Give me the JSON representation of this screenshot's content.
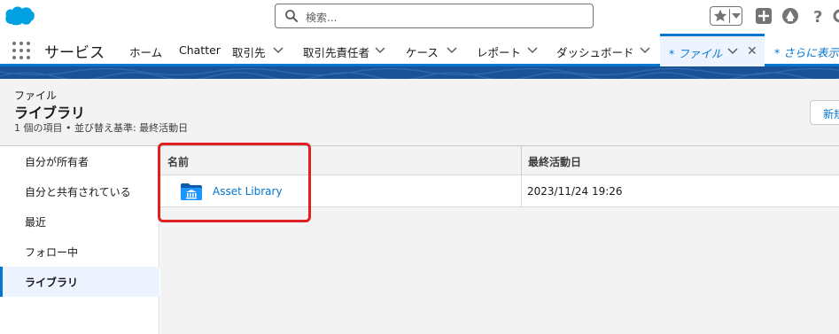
{
  "header": {
    "search_placeholder": "検索...",
    "icons": [
      "salesforce-cloud-logo",
      "search-icon",
      "star-icon",
      "add-icon",
      "trailhead-icon",
      "help-icon",
      "settings-icon"
    ]
  },
  "nav": {
    "app_name": "サービス",
    "tabs": [
      {
        "label": "ホーム",
        "dropdown": false
      },
      {
        "label": "Chatter",
        "dropdown": false
      },
      {
        "label": "取引先",
        "dropdown": true
      },
      {
        "label": "取引先責任者",
        "dropdown": true
      },
      {
        "label": "ケース",
        "dropdown": true
      },
      {
        "label": "レポート",
        "dropdown": true
      },
      {
        "label": "ダッシュボード",
        "dropdown": true
      },
      {
        "label": "* ファイル",
        "dropdown": true,
        "active": true,
        "closable": true
      }
    ],
    "more_label": "* さらに表示"
  },
  "page_header": {
    "eyebrow": "ファイル",
    "title": "ライブラリ",
    "meta": "1 個の項目 • 並び替え基準: 最終活動日",
    "new_button": "新規"
  },
  "sidebar": {
    "items": [
      {
        "label": "自分が所有者"
      },
      {
        "label": "自分と共有されている"
      },
      {
        "label": "最近"
      },
      {
        "label": "フォロー中"
      },
      {
        "label": "ライブラリ",
        "selected": true
      }
    ]
  },
  "table": {
    "columns": [
      "名前",
      "最終活動日"
    ],
    "rows": [
      {
        "name": "Asset Library",
        "last_activity": "2023/11/24 19:26",
        "icon": "library-folder-icon"
      }
    ]
  },
  "colors": {
    "brand_blue": "#0176d3",
    "highlight_red": "#e02020",
    "band_blue": "#1b5297"
  }
}
